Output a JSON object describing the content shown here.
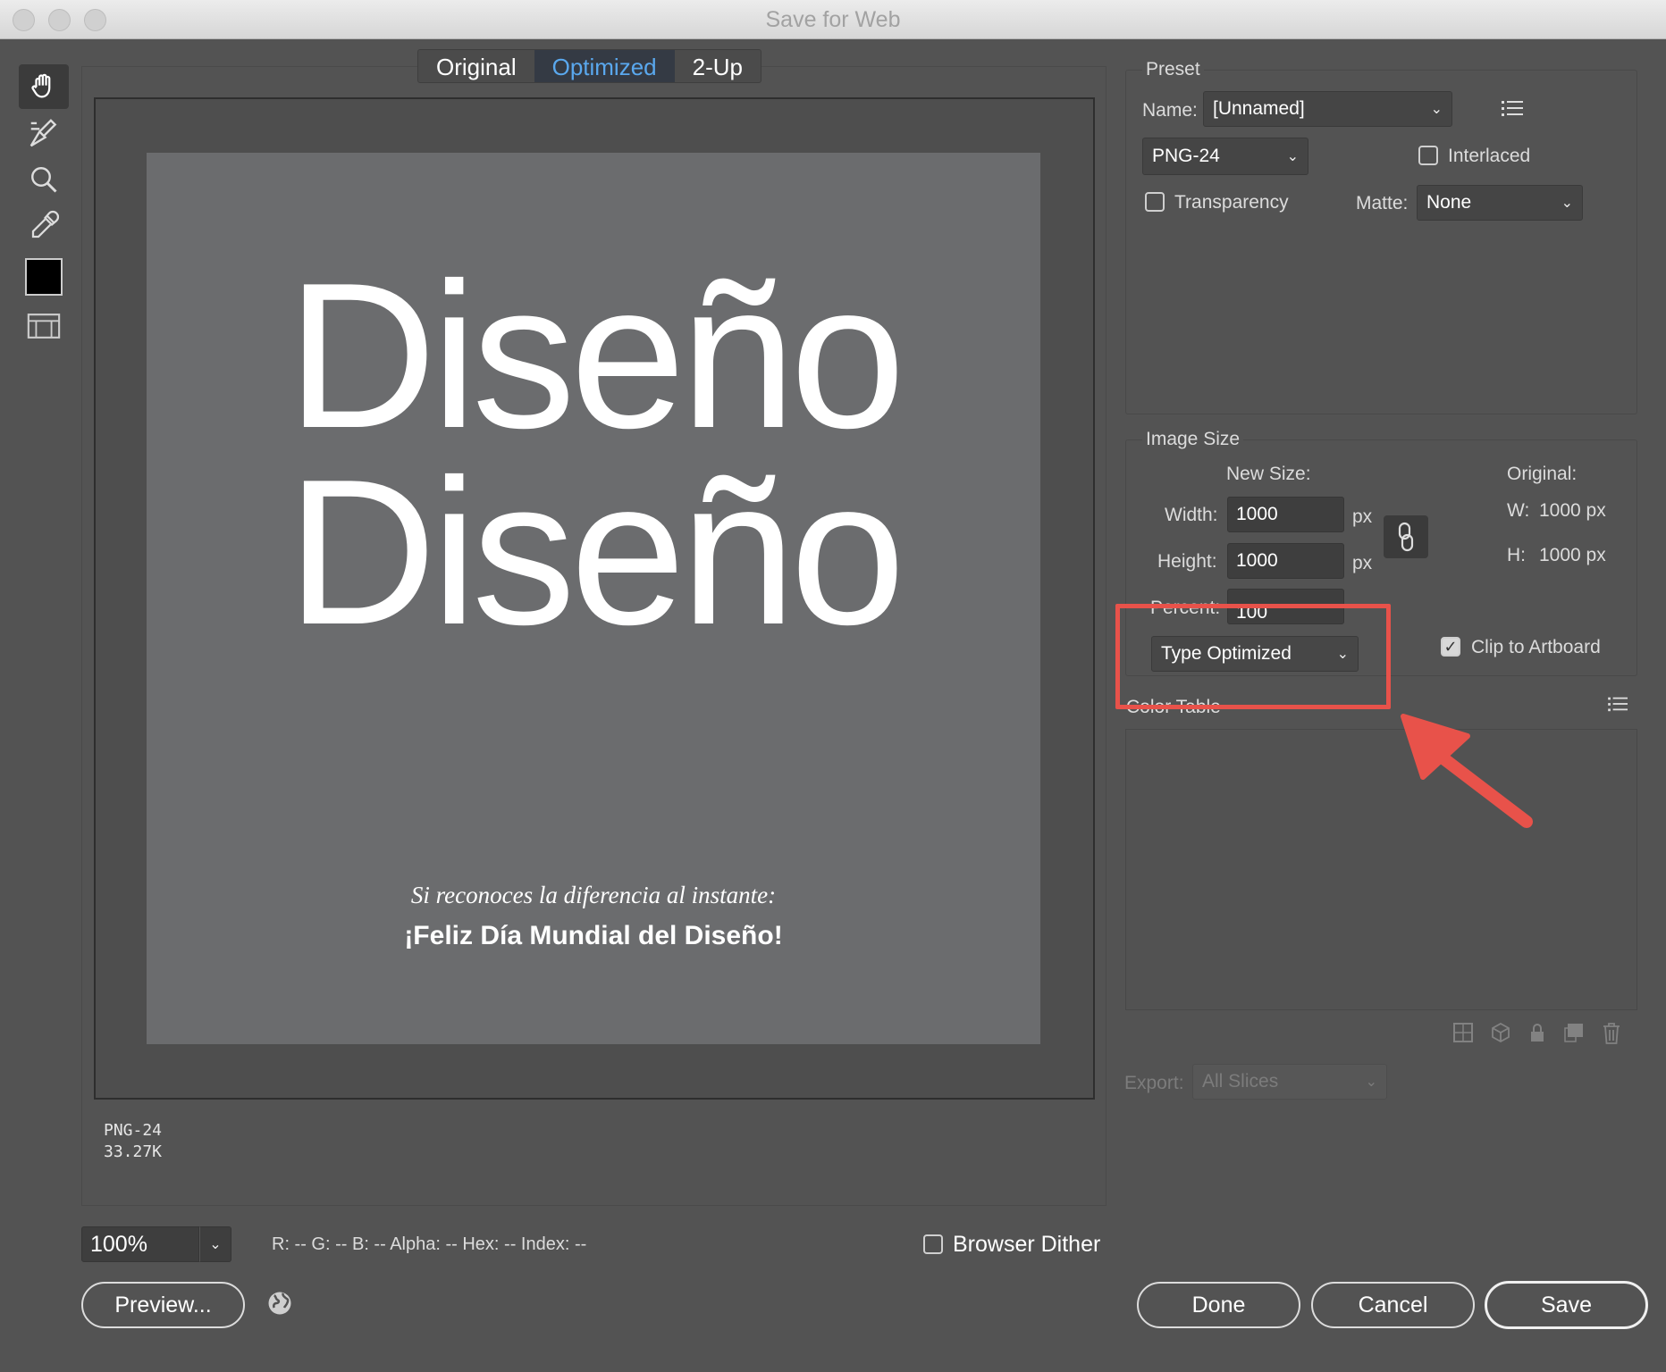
{
  "window": {
    "title": "Save for Web"
  },
  "view_tabs": [
    {
      "label": "Original"
    },
    {
      "label": "Optimized"
    },
    {
      "label": "2-Up"
    }
  ],
  "tools": [
    {
      "name": "hand-icon"
    },
    {
      "name": "slice-select-icon"
    },
    {
      "name": "zoom-icon"
    },
    {
      "name": "eyedropper-icon"
    },
    {
      "name": "color-swatch-icon",
      "color": "#000000"
    },
    {
      "name": "toggle-slices-icon"
    }
  ],
  "artwork": {
    "line1": "Diseño",
    "line2": "Diseño",
    "tagline": "Si reconoces la diferencia al instante:",
    "headline": "¡Feliz Día Mundial del Diseño!"
  },
  "image_info": {
    "format": "PNG-24",
    "size": "33.27K"
  },
  "preset": {
    "group_label": "Preset",
    "name_label": "Name:",
    "name_value": "[Unnamed]",
    "format_value": "PNG-24",
    "interlaced_label": "Interlaced",
    "interlaced_checked": false,
    "transparency_label": "Transparency",
    "transparency_checked": false,
    "matte_label": "Matte:",
    "matte_value": "None"
  },
  "image_size": {
    "group_label": "Image Size",
    "new_size_label": "New Size:",
    "width_label": "Width:",
    "width_value": "1000",
    "width_unit": "px",
    "height_label": "Height:",
    "height_value": "1000",
    "height_unit": "px",
    "percent_label": "Percent:",
    "percent_value": "100",
    "original_label": "Original:",
    "orig_w_label": "W:",
    "orig_w_value": "1000 px",
    "orig_h_label": "H:",
    "orig_h_value": "1000 px",
    "antialias_value": "Type Optimized",
    "clip_label": "Clip to Artboard",
    "clip_checked": true
  },
  "color_table": {
    "label": "Color Table"
  },
  "export": {
    "label": "Export:",
    "value": "All Slices"
  },
  "status": {
    "zoom": "100%",
    "readout": "R: -- G: -- B: -- Alpha: -- Hex: -- Index: --",
    "browser_dither_label": "Browser Dither",
    "browser_dither_checked": false
  },
  "buttons": {
    "preview": "Preview...",
    "done": "Done",
    "cancel": "Cancel",
    "save": "Save"
  },
  "colors": {
    "accent": "#5aa8ee",
    "annotation": "#e8524a",
    "panel_bg": "#535353",
    "artboard": "#6b6c6e"
  }
}
